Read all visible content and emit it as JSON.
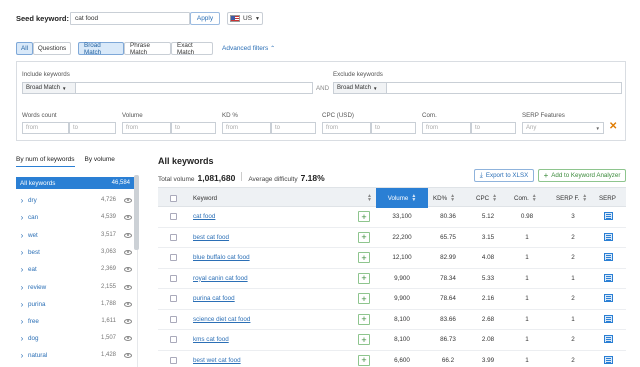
{
  "seed": {
    "label": "Seed keyword:",
    "value": "cat food",
    "apply_label": "Apply",
    "database": "US"
  },
  "match_tabs": {
    "all": "All",
    "questions": "Questions",
    "broad": "Broad Match",
    "phrase": "Phrase Match",
    "exact": "Exact Match",
    "advanced": "Advanced filters"
  },
  "filters": {
    "include_label": "Include keywords",
    "exclude_label": "Exclude keywords",
    "include_match": "Broad Match",
    "exclude_match": "Broad Match",
    "and_label": "AND",
    "words_count": "Words count",
    "volume": "Volume",
    "kd": "KD %",
    "cpc": "CPC (USD)",
    "com": "Com.",
    "serp_features": "SERP Features",
    "from": "from",
    "to": "to",
    "serp_any": "Any"
  },
  "sidebar": {
    "tab_by_num": "By num of keywords",
    "tab_by_volume": "By volume",
    "items": [
      {
        "label": "All keywords",
        "count": "46,584"
      },
      {
        "label": "dry",
        "count": "4,726"
      },
      {
        "label": "can",
        "count": "4,539"
      },
      {
        "label": "wet",
        "count": "3,517"
      },
      {
        "label": "best",
        "count": "3,063"
      },
      {
        "label": "eat",
        "count": "2,369"
      },
      {
        "label": "review",
        "count": "2,155"
      },
      {
        "label": "purina",
        "count": "1,788"
      },
      {
        "label": "free",
        "count": "1,611"
      },
      {
        "label": "dog",
        "count": "1,507"
      },
      {
        "label": "natural",
        "count": "1,428"
      }
    ]
  },
  "main": {
    "title": "All keywords",
    "total_volume_label": "Total volume",
    "total_volume": "1,081,680",
    "avg_difficulty_label": "Average difficulty",
    "avg_difficulty": "7.18%",
    "export_label": "Export to XLSX",
    "add_label": "Add to Keyword Analyzer",
    "columns": {
      "keyword": "Keyword",
      "volume": "Volume",
      "kd": "KD%",
      "cpc": "CPC",
      "com": "Com.",
      "serp_f": "SERP F.",
      "serp": "SERP"
    },
    "rows": [
      {
        "keyword": "cat food",
        "volume": "33,100",
        "kd": "80.36",
        "cpc": "5.12",
        "com": "0.98",
        "serp_f": "3"
      },
      {
        "keyword": "best cat food",
        "volume": "22,200",
        "kd": "65.75",
        "cpc": "3.15",
        "com": "1",
        "serp_f": "2"
      },
      {
        "keyword": "blue buffalo cat food",
        "volume": "12,100",
        "kd": "82.99",
        "cpc": "4.08",
        "com": "1",
        "serp_f": "2"
      },
      {
        "keyword": "royal canin cat food",
        "volume": "9,900",
        "kd": "78.34",
        "cpc": "5.33",
        "com": "1",
        "serp_f": "1"
      },
      {
        "keyword": "purina cat food",
        "volume": "9,900",
        "kd": "78.64",
        "cpc": "2.16",
        "com": "1",
        "serp_f": "2"
      },
      {
        "keyword": "science diet cat food",
        "volume": "8,100",
        "kd": "83.66",
        "cpc": "2.68",
        "com": "1",
        "serp_f": "1"
      },
      {
        "keyword": "kms cat food",
        "volume": "8,100",
        "kd": "86.73",
        "cpc": "2.08",
        "com": "1",
        "serp_f": "2"
      },
      {
        "keyword": "best wet cat food",
        "volume": "6,600",
        "kd": "66.2",
        "cpc": "3.99",
        "com": "1",
        "serp_f": "2"
      }
    ]
  }
}
